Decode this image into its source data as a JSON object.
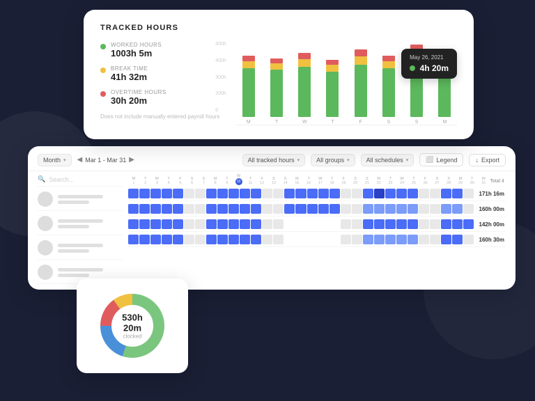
{
  "background": "#1a1f35",
  "tracked_hours_card": {
    "title": "TRACKED HOURS",
    "stats": [
      {
        "label": "WORKED HOURS",
        "value": "1003h 5m",
        "color": "green",
        "dot_color": "#5cb85c"
      },
      {
        "label": "BREAK TIME",
        "value": "41h 32m",
        "color": "yellow",
        "dot_color": "#f0c040"
      },
      {
        "label": "OVERTIME HOURS",
        "value": "30h 20m",
        "color": "red",
        "dot_color": "#e05c5c"
      }
    ],
    "note": "Does not include manually entered payroll hours",
    "y_axis": [
      "500h",
      "400h",
      "300h",
      "200h",
      ""
    ],
    "bars": [
      {
        "green": 70,
        "yellow": 10,
        "red": 8,
        "label": "M"
      },
      {
        "green": 68,
        "yellow": 9,
        "red": 7,
        "label": "T"
      },
      {
        "green": 72,
        "yellow": 11,
        "red": 9,
        "label": "W"
      },
      {
        "green": 65,
        "yellow": 10,
        "red": 7,
        "label": "T"
      },
      {
        "green": 75,
        "yellow": 12,
        "red": 10,
        "label": "F"
      },
      {
        "green": 70,
        "yellow": 10,
        "red": 8,
        "label": "S"
      },
      {
        "green": 80,
        "yellow": 13,
        "red": 11,
        "label": "S"
      },
      {
        "green": 73,
        "yellow": 11,
        "red": 9,
        "label": "M"
      }
    ],
    "tooltip": {
      "date": "May 26, 2021",
      "value": "4h 20m",
      "color": "#5cb85c"
    }
  },
  "tracker_card": {
    "toolbar": {
      "month_btn": "Month",
      "date_range": "Mar 1 - Mar 31",
      "filter1": "All tracked hours",
      "filter2": "All groups",
      "filter3": "All schedules",
      "legend_btn": "Legend",
      "export_btn": "Export"
    },
    "search_placeholder": "Search...",
    "day_letters": [
      "M",
      "T",
      "W",
      "T",
      "F",
      "S",
      "S"
    ],
    "day_numbers": [
      [
        "1",
        "2",
        "3",
        "4",
        "5",
        "6",
        "7"
      ],
      [
        "8",
        "9",
        "10",
        "11",
        "12",
        "13",
        "14"
      ],
      [
        "15",
        "16",
        "17",
        "18",
        "19",
        "20",
        "21"
      ],
      [
        "22",
        "23",
        "24",
        "25",
        "26",
        "27",
        "28"
      ],
      [
        "29",
        "30",
        "31"
      ]
    ],
    "today": "10",
    "total_header": "Total 4",
    "rows": [
      {
        "total": "171h 16m"
      },
      {
        "total": "160h 00m"
      },
      {
        "total": "142h 00m"
      },
      {
        "total": "160h 30m"
      }
    ]
  },
  "donut_card": {
    "value": "530h 20m",
    "label": "clocked",
    "segments": [
      {
        "color": "#e05c5c",
        "pct": 15
      },
      {
        "color": "#f0c040",
        "pct": 10
      },
      {
        "color": "#5cb85c",
        "pct": 55
      },
      {
        "color": "#4a90d9",
        "pct": 20
      }
    ]
  }
}
